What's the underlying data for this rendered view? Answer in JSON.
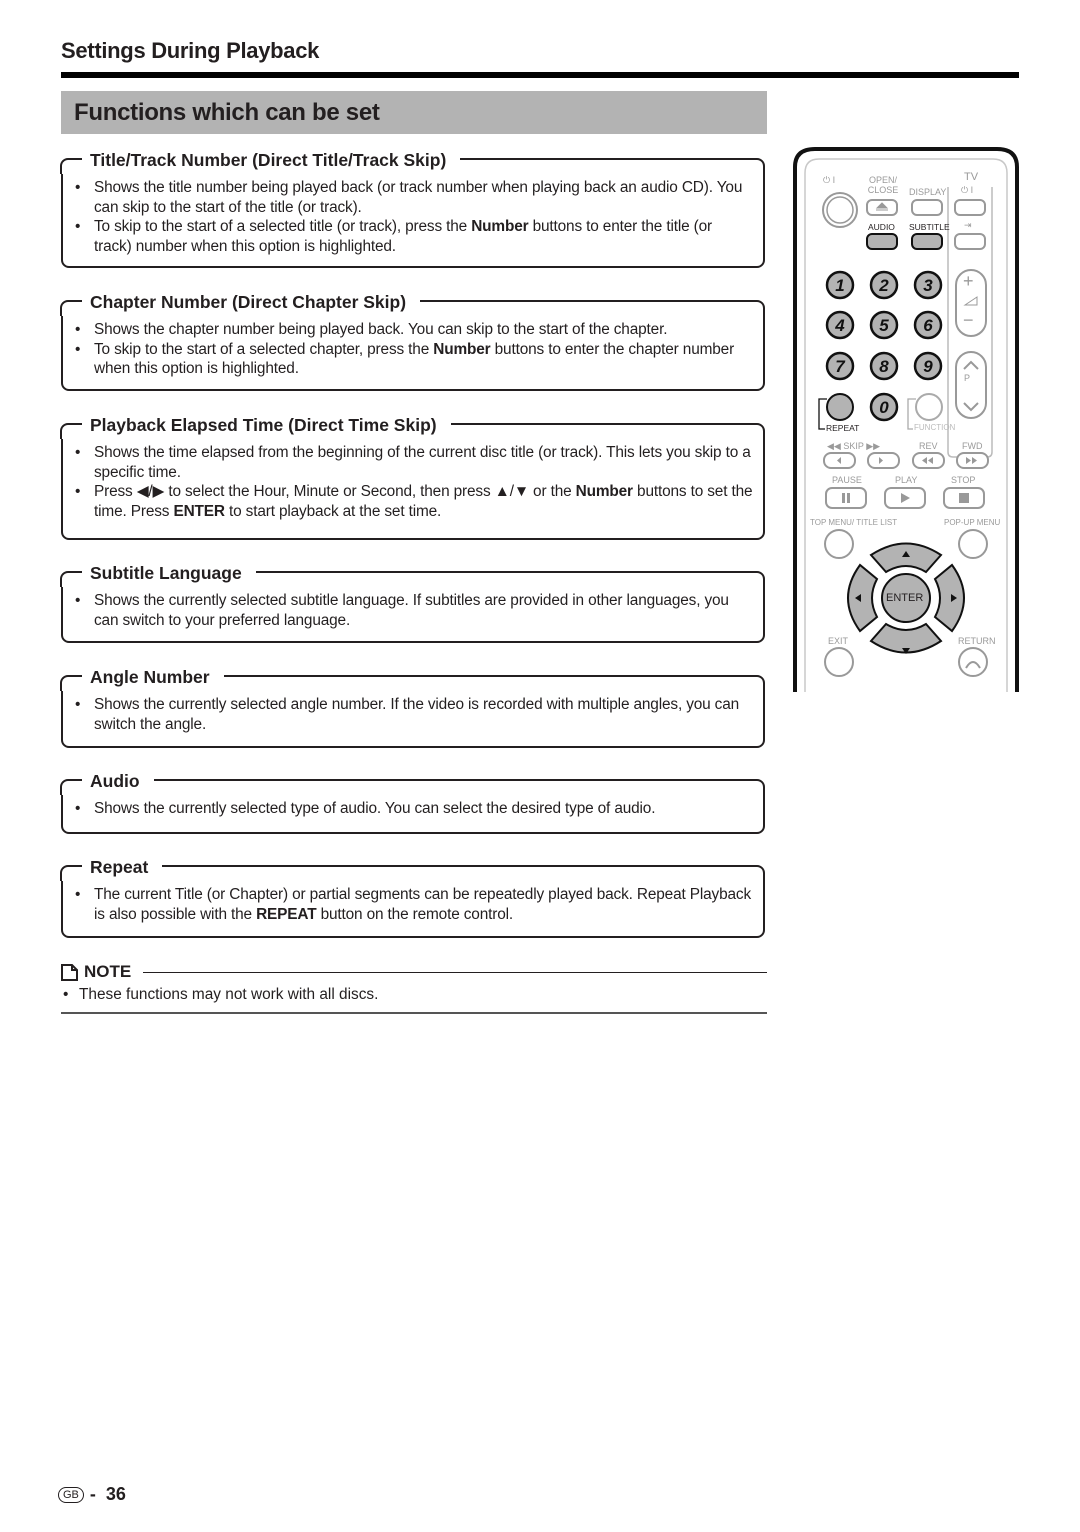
{
  "header": {
    "section": "Settings During Playback",
    "band": "Functions which can be set"
  },
  "boxes": [
    {
      "title": "Title/Track Number (Direct Title/Track Skip)",
      "items": [
        "Shows the title number being played back (or track number when playing back an audio CD). You can skip to the start of the title (or track).",
        "To skip to the start of a selected title (or track), press the Number buttons to enter the title (or track) number when this option is highlighted."
      ]
    },
    {
      "title": "Chapter Number (Direct Chapter Skip)",
      "items": [
        "Shows the chapter number being played back. You can skip to the start of the chapter.",
        "To skip to the start of a selected chapter, press the Number buttons to enter the chapter number when this option is highlighted."
      ]
    },
    {
      "title": "Playback Elapsed Time (Direct Time Skip)",
      "items": [
        "Shows the time elapsed from the beginning of the current disc title (or track). This lets you skip to a specific time.",
        "Press ◀/▶ to select the Hour, Minute or Second, then press ▲/▼ or the Number buttons to set the time. Press ENTER to start playback at the set time."
      ]
    },
    {
      "title": "Subtitle Language",
      "items": [
        "Shows the currently selected subtitle language. If subtitles are provided in other languages, you can switch to your preferred language."
      ]
    },
    {
      "title": "Angle Number",
      "items": [
        "Shows the currently selected angle number. If the video is recorded with multiple angles, you can switch the angle."
      ]
    },
    {
      "title": "Audio",
      "items": [
        "Shows the currently selected type of audio. You can select the desired type of audio."
      ]
    },
    {
      "title": "Repeat",
      "items": [
        "The current Title (or Chapter) or partial segments can be repeatedly played back. Repeat Playback is also possible with the REPEAT button on the remote control."
      ]
    }
  ],
  "bold_terms": [
    "Number",
    "ENTER",
    "REPEAT"
  ],
  "note": {
    "label": "NOTE",
    "text": "These functions may not work with all discs."
  },
  "footer": {
    "region": "GB",
    "page": "36"
  },
  "remote": {
    "power": "⏻ I",
    "open_close": "OPEN/ CLOSE",
    "display": "DISPLAY",
    "tv": "TV",
    "tv_power": "⏻ I",
    "audio": "AUDIO",
    "subtitle": "SUBTITLE",
    "input": "⇥",
    "digits": [
      "1",
      "2",
      "3",
      "4",
      "5",
      "6",
      "7",
      "8",
      "9",
      "0"
    ],
    "vol_plus": "+",
    "vol_minus": "−",
    "ch_label": "P",
    "repeat": "REPEAT",
    "function": "FUNCTION",
    "skip": "◀◀ SKIP ▶▶",
    "rev": "REV",
    "fwd": "FWD",
    "pause": "PAUSE",
    "play": "PLAY",
    "stop": "STOP",
    "top_menu": "TOP MENU/ TITLE LIST",
    "popup_menu": "POP-UP MENU",
    "enter": "ENTER",
    "exit": "EXIT",
    "return": "RETURN",
    "highlight_color": "#b3b3b3"
  }
}
